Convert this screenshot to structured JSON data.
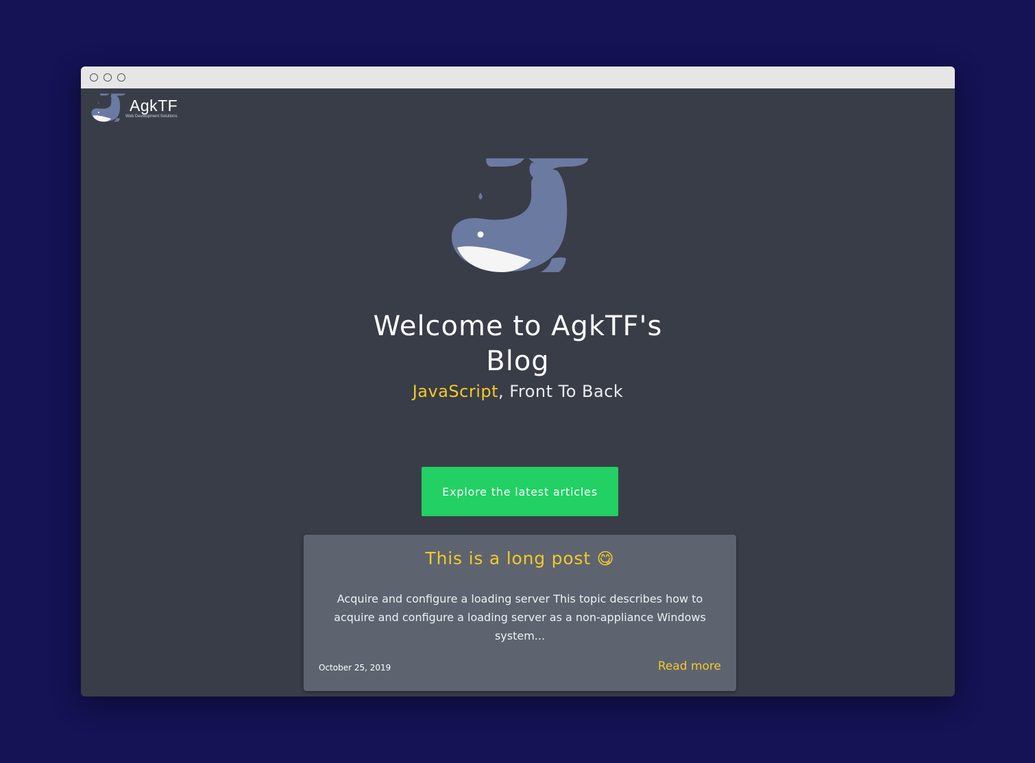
{
  "browser": {
    "window_controls": [
      "close",
      "minimize",
      "maximize"
    ]
  },
  "header": {
    "logo_text": "AgkTF",
    "logo_subtitle": "Web Development Solutions",
    "logo_icon": "whale-icon"
  },
  "hero": {
    "icon": "whale-icon",
    "title_line1": "Welcome to AgkTF's",
    "title_line2": "Blog",
    "subtitle_accent": "JavaScript",
    "subtitle_rest": ", Front To Back",
    "cta_label": "Explore the latest articles"
  },
  "post": {
    "title": "This is a long post",
    "title_emoji": "😋",
    "excerpt": "Acquire and configure a loading server This topic describes how to acquire and configure a loading server as a non-appliance Windows system...",
    "date": "October 25, 2019",
    "read_more": "Read more"
  },
  "colors": {
    "page_background": "#151255",
    "window_background": "#393d47",
    "accent_yellow": "#f6c82a",
    "cta_green": "#22d064",
    "card_background": "#5d6470",
    "whale_blue": "#6b7aa1"
  }
}
